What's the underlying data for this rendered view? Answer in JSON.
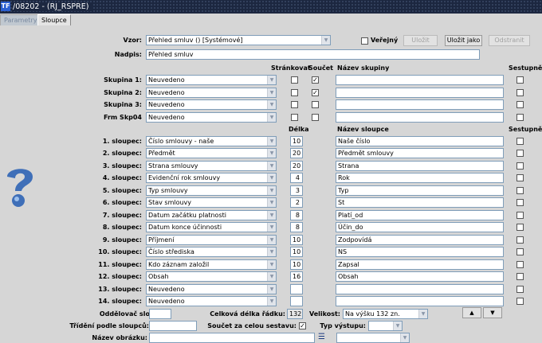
{
  "window": {
    "title": "/08202 - (RJ_RSPRE)",
    "icon": "TF"
  },
  "tabs": [
    {
      "label": "Parametry",
      "active": false
    },
    {
      "label": "Sloupce",
      "active": true
    }
  ],
  "vzor": {
    "label": "Vzor:",
    "value": "Přehled smluv   ()   [Systémové]"
  },
  "verejny": {
    "label": "Veřejný",
    "checked": false
  },
  "buttons": {
    "ulozit": "Uložit",
    "ulozit_jako": "Uložit jako",
    "odstranit": "Odstranit"
  },
  "nadpis": {
    "label": "Nadpis:",
    "value": "Přehled smluv"
  },
  "group_headers": {
    "strankovat": "Stránkovat",
    "soucet": "Součet",
    "nazev": "Název skupiny",
    "sestupne": "Sestupně"
  },
  "groups": [
    {
      "label": "Skupina 1:",
      "value": "Neuvedeno",
      "strankovat": false,
      "soucet": true,
      "nazev": "",
      "sestupne": false
    },
    {
      "label": "Skupina 2:",
      "value": "Neuvedeno",
      "strankovat": false,
      "soucet": true,
      "nazev": "",
      "sestupne": false
    },
    {
      "label": "Skupina 3:",
      "value": "Neuvedeno",
      "strankovat": false,
      "soucet": false,
      "nazev": "",
      "sestupne": false
    },
    {
      "label": "Frm Skp04",
      "value": "Neuvedeno",
      "strankovat": false,
      "soucet": false,
      "nazev": "",
      "sestupne": false
    }
  ],
  "column_headers": {
    "delka": "Délka",
    "nazev": "Název sloupce",
    "sestupne": "Sestupně"
  },
  "columns": [
    {
      "label": "1. sloupec:",
      "value": "Číslo smlouvy - naše",
      "delka": "10",
      "nazev": "Naše číslo",
      "sestupne": false
    },
    {
      "label": "2. sloupec:",
      "value": "Předmět",
      "delka": "20",
      "nazev": "Předmět smlouvy",
      "sestupne": false
    },
    {
      "label": "3. sloupec:",
      "value": "Strana smlouvy",
      "delka": "20",
      "nazev": "Strana",
      "sestupne": false
    },
    {
      "label": "4. sloupec:",
      "value": "Evidenční rok smlouvy",
      "delka": "4",
      "nazev": "Rok",
      "sestupne": false
    },
    {
      "label": "5. sloupec:",
      "value": "Typ smlouvy",
      "delka": "3",
      "nazev": "Typ",
      "sestupne": false
    },
    {
      "label": "6. sloupec:",
      "value": "Stav smlouvy",
      "delka": "2",
      "nazev": "St",
      "sestupne": false
    },
    {
      "label": "7. sloupec:",
      "value": "Datum začátku platnosti",
      "delka": "8",
      "nazev": "Platí_od",
      "sestupne": false
    },
    {
      "label": "8. sloupec:",
      "value": "Datum konce účinnosti",
      "delka": "8",
      "nazev": "Účin_do",
      "sestupne": false
    },
    {
      "label": "9. sloupec:",
      "value": "Příjmení",
      "delka": "10",
      "nazev": "Zodpovídá",
      "sestupne": false
    },
    {
      "label": "10. sloupec:",
      "value": "Číslo střediska",
      "delka": "10",
      "nazev": "NS",
      "sestupne": false
    },
    {
      "label": "11. sloupec:",
      "value": "Kdo záznam založil",
      "delka": "10",
      "nazev": "Zapsal",
      "sestupne": false
    },
    {
      "label": "12. sloupec:",
      "value": "Obsah",
      "delka": "16",
      "nazev": "Obsah",
      "sestupne": false
    },
    {
      "label": "13. sloupec:",
      "value": "Neuvedeno",
      "delka": "",
      "nazev": "",
      "sestupne": false
    },
    {
      "label": "14. sloupec:",
      "value": "Neuvedeno",
      "delka": "",
      "nazev": "",
      "sestupne": false
    }
  ],
  "footer": {
    "oddelovac": {
      "label": "Oddělovač sloupců:",
      "value": ""
    },
    "celkova": {
      "label": "Celková délka řádku:",
      "value": "132"
    },
    "velikost": {
      "label": "Velikost:",
      "value": "Na výšku 132 zn."
    },
    "trideni": {
      "label": "Třídění podle sloupců:",
      "value": ""
    },
    "soucet_celkem": {
      "label": "Součet za celou sestavu:",
      "checked": true
    },
    "typ_vystupu": {
      "label": "Typ výstupu:",
      "value": ""
    },
    "nazev_obrazku": {
      "label": "Název obrázku:",
      "value": "",
      "extra_value": ""
    }
  },
  "icons": {
    "help": "help-question-icon",
    "up": "arrow-up-icon",
    "down": "arrow-down-icon",
    "list": "list-icon"
  }
}
